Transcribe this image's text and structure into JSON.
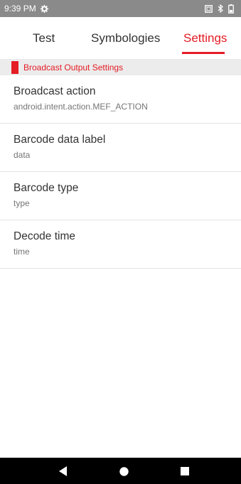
{
  "status_bar": {
    "time": "9:39 PM",
    "icons": [
      "settings-gear-icon",
      "screenshot-icon",
      "bluetooth-icon",
      "battery-icon"
    ]
  },
  "tabs": [
    {
      "label": "Test",
      "active": false
    },
    {
      "label": "Symbologies",
      "active": false
    },
    {
      "label": "Settings",
      "active": true
    }
  ],
  "section": {
    "title": "Broadcast Output Settings"
  },
  "settings": [
    {
      "title": "Broadcast action",
      "value": "android.intent.action.MEF_ACTION"
    },
    {
      "title": "Barcode data label",
      "value": "data"
    },
    {
      "title": "Barcode type",
      "value": "type"
    },
    {
      "title": "Decode time",
      "value": "time"
    }
  ],
  "colors": {
    "accent": "#e41c24",
    "status_bar": "#8a8a8a",
    "nav_bar": "#000000",
    "section_bg": "#ececec"
  },
  "nav_bar": {
    "buttons": [
      "back-icon",
      "home-icon",
      "recents-icon"
    ]
  }
}
